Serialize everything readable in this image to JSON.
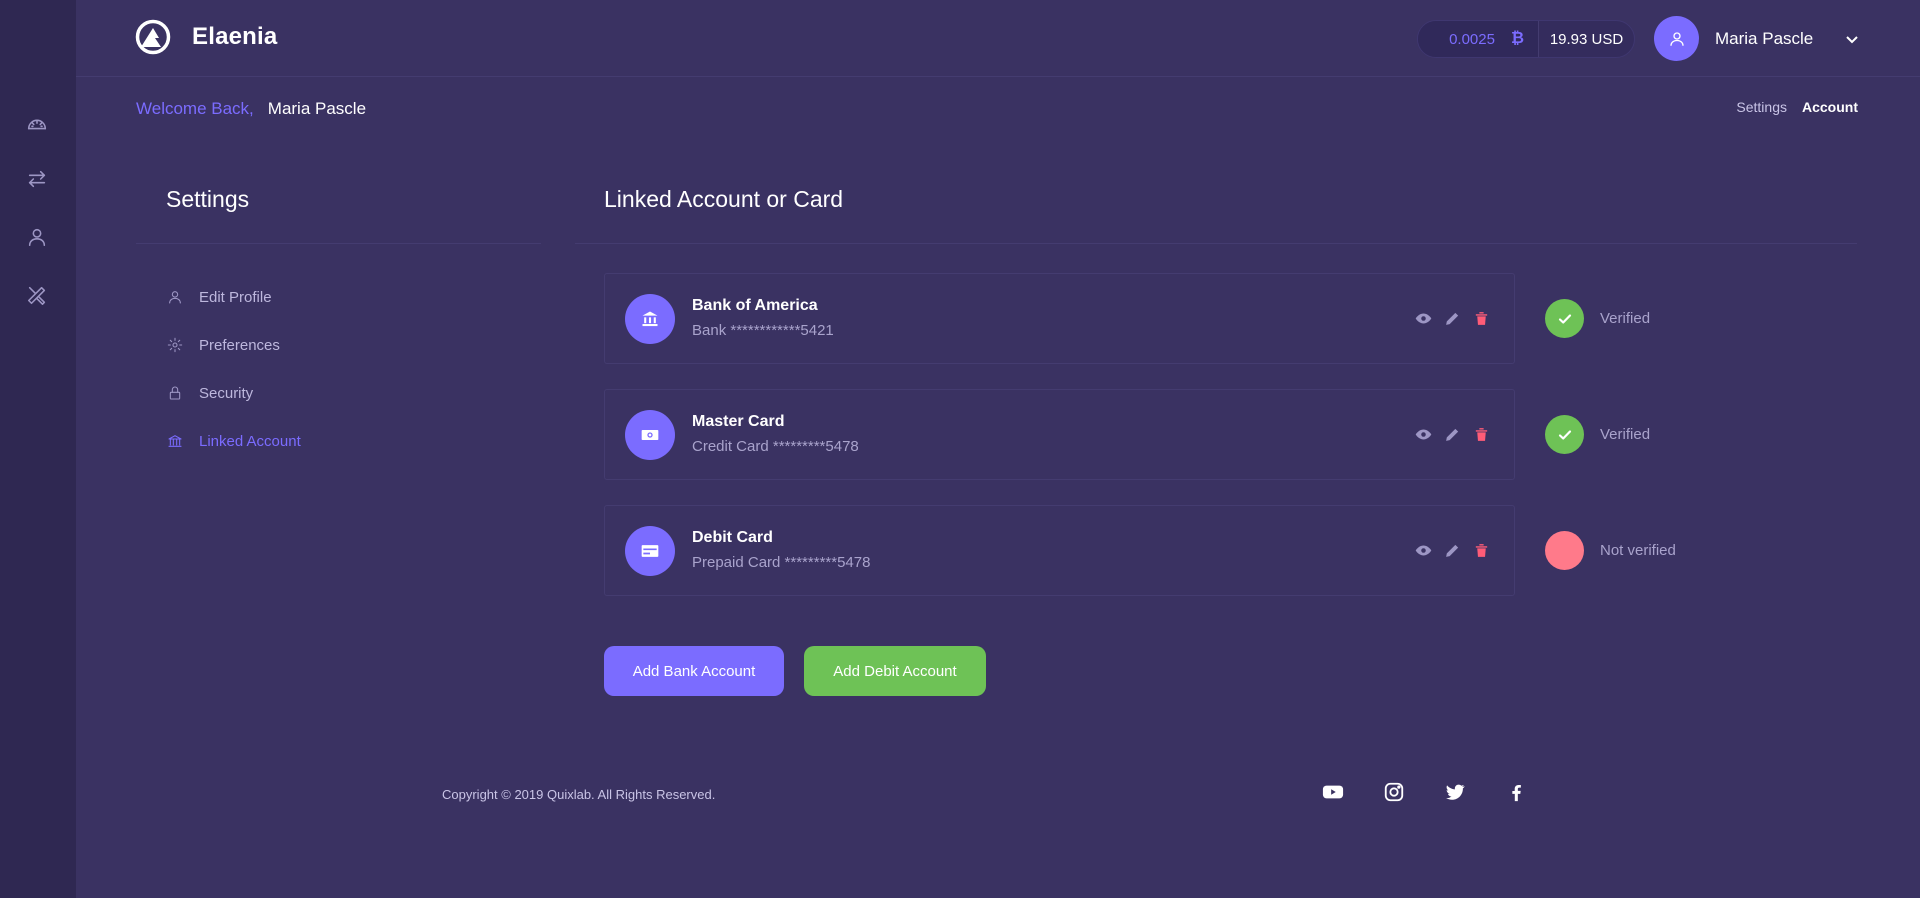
{
  "app": {
    "name": "Elaenia"
  },
  "balance": {
    "btc_value": "0.0025",
    "btc_symbol": "₿",
    "usd_value": "19.93 USD"
  },
  "user": {
    "name": "Maria Pascle"
  },
  "welcome": {
    "label": "Welcome Back,",
    "name": "Maria Pascle"
  },
  "breadcrumb": {
    "items": [
      "Settings",
      "Account"
    ]
  },
  "settings": {
    "title": "Settings",
    "menu": [
      {
        "label": "Edit Profile",
        "icon": "user-icon"
      },
      {
        "label": "Preferences",
        "icon": "gear-icon"
      },
      {
        "label": "Security",
        "icon": "lock-icon"
      },
      {
        "label": "Linked Account",
        "icon": "bank-icon"
      }
    ]
  },
  "linked": {
    "title": "Linked Account or Card",
    "accounts": [
      {
        "name": "Bank of America",
        "number": "Bank ************5421",
        "icon": "bank-icon",
        "status": "Verified",
        "status_color": "#6ec256"
      },
      {
        "name": "Master Card",
        "number": "Credit Card *********5478",
        "icon": "money-icon",
        "status": "Verified",
        "status_color": "#6ec256"
      },
      {
        "name": "Debit Card",
        "number": "Prepaid Card *********5478",
        "icon": "credit-card-icon",
        "status": "Not verified",
        "status_color": "#ff7a8a"
      }
    ]
  },
  "buttons": {
    "add_bank": "Add Bank Account",
    "add_debit": "Add Debit Account"
  },
  "footer": {
    "copyright": "Copyright © 2019 Quixlab. All Rights Reserved.",
    "socials": [
      "youtube-icon",
      "instagram-icon",
      "twitter-icon",
      "facebook-icon"
    ]
  },
  "colors": {
    "accent": "#7b6cff",
    "success": "#6ec256",
    "danger": "#ff7a8a",
    "background": "#3a3262",
    "sidebar": "#2f2852"
  }
}
